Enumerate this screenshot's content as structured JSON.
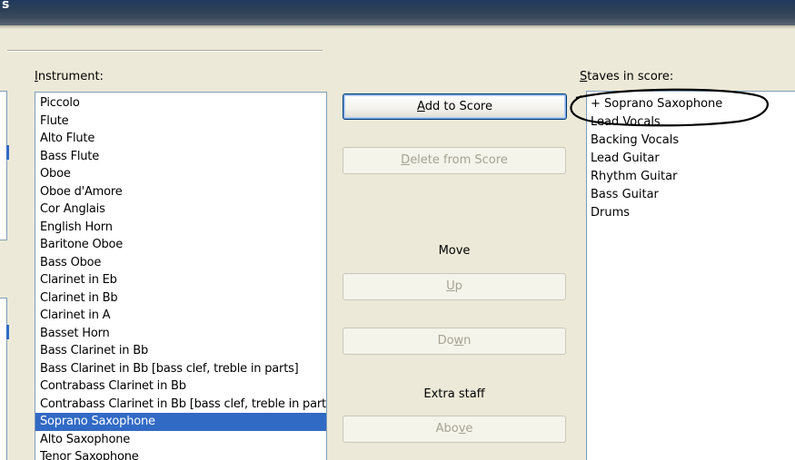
{
  "window": {
    "title": "s"
  },
  "instrument": {
    "label_pre": "",
    "label_ul": "I",
    "label_post": "nstrument:",
    "items": [
      "Piccolo",
      "Flute",
      "Alto Flute",
      "Bass Flute",
      "Oboe",
      "Oboe d'Amore",
      "Cor Anglais",
      "English Horn",
      "Baritone Oboe",
      "Bass Oboe",
      "Clarinet in Eb",
      "Clarinet in Bb",
      "Clarinet in A",
      "Basset Horn",
      "Bass Clarinet in Bb",
      "Bass Clarinet in Bb [bass clef, treble in parts]",
      "Contrabass Clarinet in Bb",
      "Contrabass Clarinet in Bb [bass clef, treble in parts]",
      "Soprano Saxophone",
      "Alto Saxophone",
      "Tenor Saxophone"
    ],
    "selected_index": 18
  },
  "buttons": {
    "add_pre": "",
    "add_ul": "A",
    "add_post": "dd to Score",
    "delete_pre": "",
    "delete_ul": "D",
    "delete_post": "elete from Score",
    "up_pre": "",
    "up_ul": "U",
    "up_post": "p",
    "down_pre": "Do",
    "down_ul": "w",
    "down_post": "n",
    "above_pre": "Abo",
    "above_ul": "v",
    "above_post": "e"
  },
  "move": {
    "label": "Move"
  },
  "extra_staff": {
    "label": "Extra staff"
  },
  "staves": {
    "label_pre": "",
    "label_ul": "S",
    "label_post": "taves in score:",
    "items": [
      "+ Soprano Saxophone",
      "Lead Vocals",
      "Backing Vocals",
      "Lead Guitar",
      "Rhythm Guitar",
      "Bass Guitar",
      "Drums"
    ]
  },
  "colors": {
    "selection": "#316ac5",
    "annotation": "#000000"
  }
}
